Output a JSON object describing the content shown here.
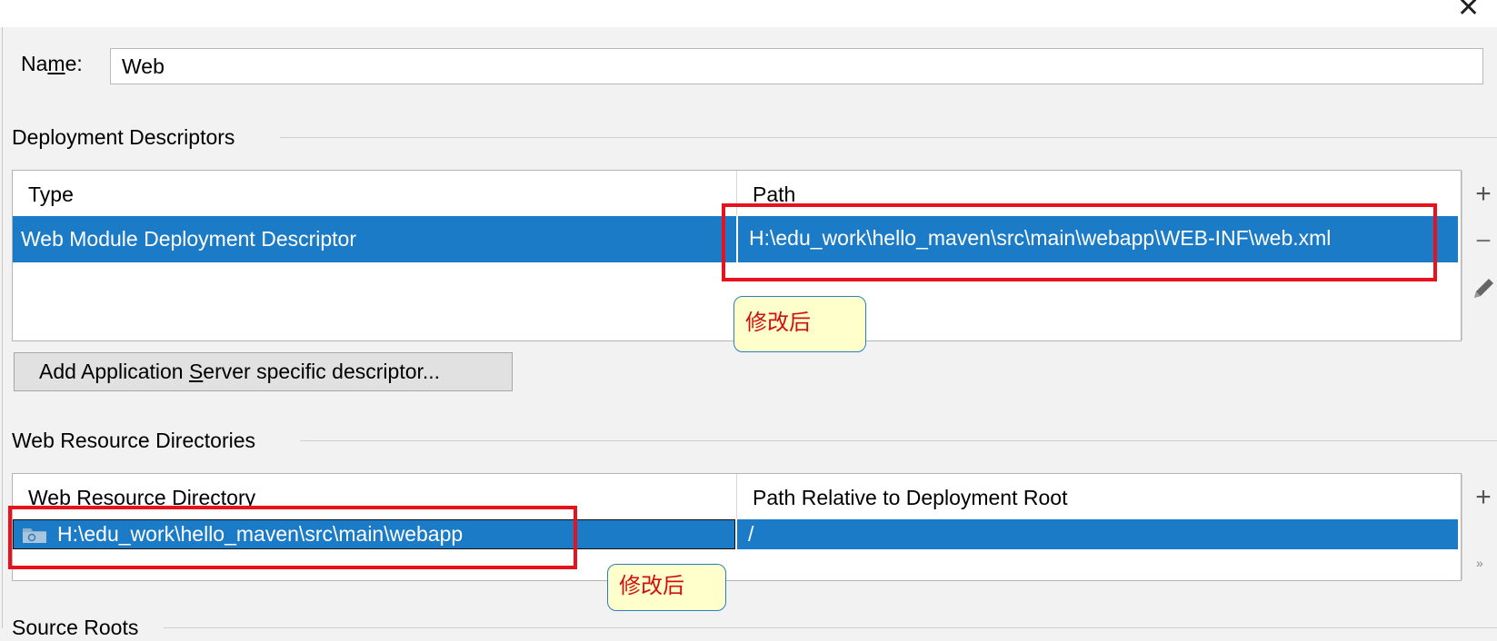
{
  "window": {
    "close_icon": "close-icon"
  },
  "name_field": {
    "label_pre": "Na",
    "label_mnemonic": "m",
    "label_post": "e:",
    "value": "Web"
  },
  "deployment_descriptors": {
    "title": "Deployment Descriptors",
    "columns": [
      "Type",
      "Path"
    ],
    "rows": [
      {
        "type": "Web Module Deployment Descriptor",
        "path": "H:\\edu_work\\hello_maven\\src\\main\\webapp\\WEB-INF\\web.xml"
      }
    ],
    "add_button": {
      "pre": "Add Application ",
      "mnemonic": "S",
      "post": "erver specific descriptor..."
    }
  },
  "web_resource_directories": {
    "title": "Web Resource Directories",
    "columns": [
      "Web Resource Directory",
      "Path Relative to Deployment Root"
    ],
    "rows": [
      {
        "directory": "H:\\edu_work\\hello_maven\\src\\main\\webapp",
        "relative_path": "/"
      }
    ]
  },
  "source_roots": {
    "title": "Source Roots"
  },
  "annotations": {
    "note_1": "修改后",
    "note_2": "修改后"
  },
  "toolbar": {
    "add_icon": "plus-icon",
    "remove_icon": "minus-icon",
    "edit_icon": "pencil-icon",
    "more_icon": "chevron-double-right-icon",
    "more_glyph": "»"
  },
  "colors": {
    "selection": "#1c7bc7",
    "highlight_box": "#e8121f",
    "note_background": "#ffffcc",
    "note_text": "#d01010"
  }
}
